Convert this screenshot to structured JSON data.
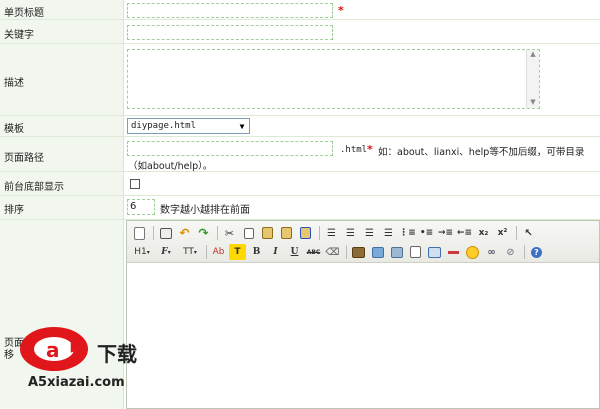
{
  "form": {
    "title_label": "单页标题",
    "keyword_label": "关键字",
    "description_label": "描述",
    "template_label": "模板",
    "template_value": "diypage.html",
    "path_label": "页面路径",
    "path_suffix": ".html",
    "path_hint_line1": "如：about、lianxi、help等不加后缀，可带目录",
    "path_hint_line2": "（如about/help）。",
    "footer_label": "前台底部显示",
    "sort_label": "排序",
    "sort_value": "6",
    "sort_hint": "数字越小越排在前面",
    "content_label_partial_1": "页面",
    "content_label_partial_2": "移",
    "required_mark": "*"
  },
  "toolbar": {
    "heading_btn": "H1",
    "font_btn": "F",
    "size_btn": "TT",
    "subscript_label": "x₂",
    "superscript_label": "x²",
    "bold_label": "B",
    "italic_label": "I",
    "underline_label": "U",
    "strike_label": "ABC",
    "color_label": "Ab",
    "highlight_label": "T"
  },
  "watermark": {
    "brand": "a5",
    "download": "下载",
    "domain": "A5xiazai.com"
  },
  "colors": {
    "label_bg": "#f1f6ee",
    "field_border": "#9fd09a",
    "required": "#dd1111",
    "watermark_red": "#e0161b"
  }
}
